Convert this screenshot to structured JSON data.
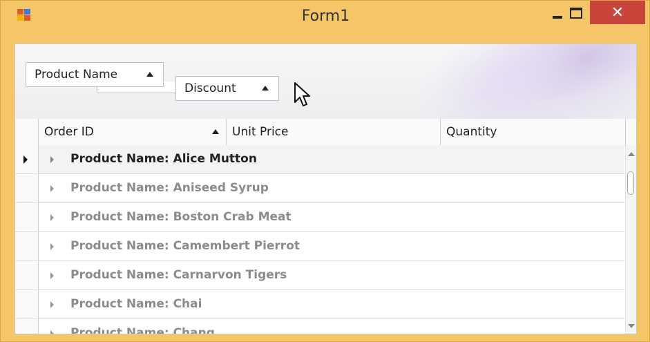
{
  "window": {
    "title": "Form1",
    "close_glyph": "✕"
  },
  "group_panel": {
    "chips": [
      {
        "label": "Product Name",
        "sort": "ascending"
      },
      {
        "label": "Discount",
        "sort": "ascending"
      }
    ]
  },
  "columns": [
    {
      "label": "Order ID",
      "sort": "ascending"
    },
    {
      "label": "Unit Price"
    },
    {
      "label": "Quantity"
    }
  ],
  "rows": [
    {
      "label": "Product Name: Alice Mutton",
      "selected": true
    },
    {
      "label": "Product Name: Aniseed Syrup"
    },
    {
      "label": "Product Name: Boston Crab Meat"
    },
    {
      "label": "Product Name: Camembert Pierrot"
    },
    {
      "label": "Product Name: Carnarvon Tigers"
    },
    {
      "label": "Product Name: Chai"
    },
    {
      "label": "Product Name: Chang"
    }
  ],
  "colors": {
    "window_frame": "#f4c668",
    "close_button": "#c9443a",
    "group_text": "#8c8c8c"
  }
}
